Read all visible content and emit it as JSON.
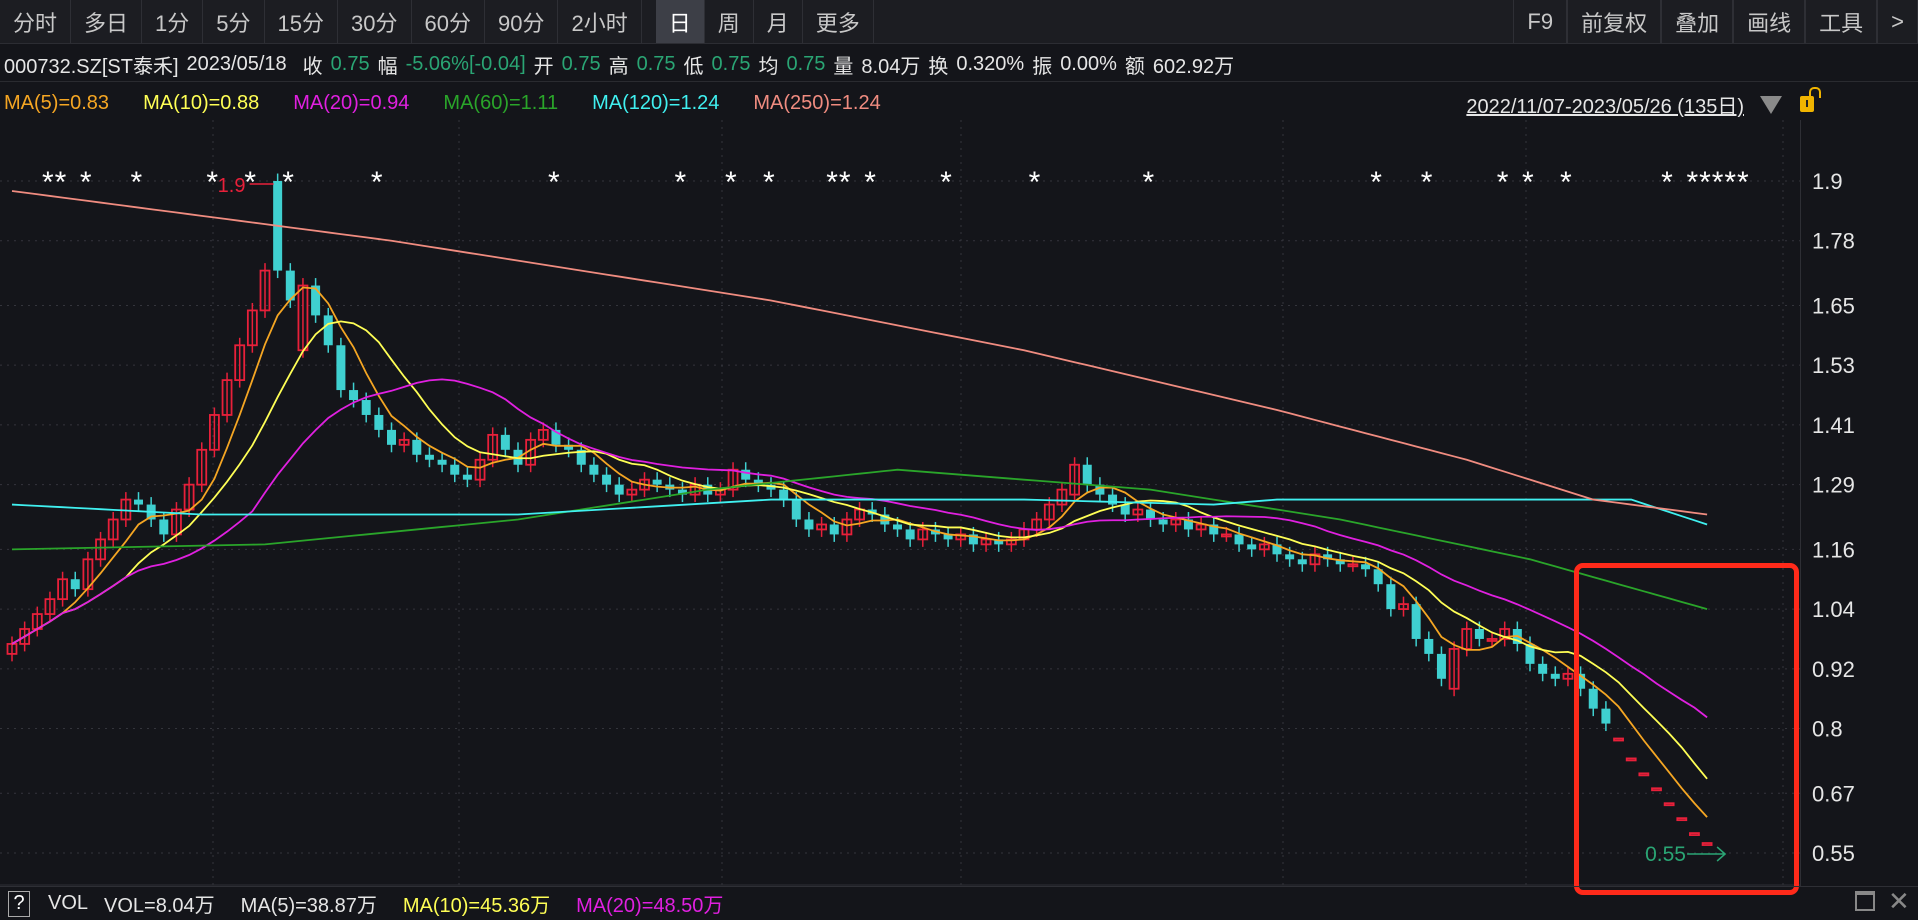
{
  "tabs_left": [
    "分时",
    "多日",
    "1分",
    "5分",
    "15分",
    "30分",
    "60分",
    "90分",
    "2小时",
    "日",
    "周",
    "月",
    "更多"
  ],
  "selected_tab": "日",
  "tabs_right": [
    "F9",
    "前复权",
    "叠加",
    "画线",
    "工具",
    ">"
  ],
  "info": {
    "symbol": "000732.SZ[ST泰禾]",
    "date": "2023/05/18",
    "close_label": "收",
    "close": "0.75",
    "change_label": "幅",
    "change": "-5.06%[-0.04]",
    "open_label": "开",
    "open": "0.75",
    "high_label": "高",
    "high": "0.75",
    "low_label": "低",
    "low": "0.75",
    "avg_label": "均",
    "avg": "0.75",
    "vol_label": "量",
    "vol": "8.04万",
    "turnover_label": "换",
    "turnover": "0.320%",
    "amp_label": "振",
    "amp": "0.00%",
    "amount_label": "额",
    "amount": "602.92万"
  },
  "ma_legend": [
    {
      "text": "MA(5)=0.83",
      "color": "#f5a623"
    },
    {
      "text": "MA(10)=0.88",
      "color": "#ffff55"
    },
    {
      "text": "MA(20)=0.94",
      "color": "#e020e0"
    },
    {
      "text": "MA(60)=1.11",
      "color": "#2aa52a"
    },
    {
      "text": "MA(120)=1.24",
      "color": "#40f0f0"
    },
    {
      "text": "MA(250)=1.24",
      "color": "#f08c80"
    }
  ],
  "range": "2022/11/07-2023/05/26 (135日)",
  "bottom": {
    "help": "?",
    "vol_title": "VOL",
    "vol": "VOL=8.04万",
    "ma5": "MA(5)=38.87万",
    "ma10": "MA(10)=45.36万",
    "ma20": "MA(20)=48.50万"
  },
  "colors": {
    "up": "#e8203a",
    "down": "#3fd0d0",
    "highlight_box": "#ff2a1a"
  },
  "chart_data": {
    "type": "candlestick",
    "ylim": [
      0.55,
      1.9
    ],
    "yticks": [
      "1.9",
      "1.78",
      "1.65",
      "1.53",
      "1.41",
      "1.29",
      "1.16",
      "1.04",
      "0.92",
      "0.8",
      "0.67",
      "0.55"
    ],
    "max_label": "1.9",
    "min_label": "0.55",
    "max_index": 21,
    "min_index": 134,
    "closes": [
      0.97,
      1.0,
      1.03,
      1.06,
      1.1,
      1.08,
      1.14,
      1.18,
      1.22,
      1.26,
      1.25,
      1.22,
      1.19,
      1.24,
      1.29,
      1.36,
      1.43,
      1.5,
      1.57,
      1.64,
      1.72,
      1.72,
      1.66,
      1.69,
      1.63,
      1.57,
      1.48,
      1.46,
      1.43,
      1.4,
      1.37,
      1.38,
      1.35,
      1.34,
      1.33,
      1.31,
      1.3,
      1.34,
      1.39,
      1.36,
      1.33,
      1.38,
      1.4,
      1.37,
      1.36,
      1.33,
      1.31,
      1.29,
      1.27,
      1.28,
      1.3,
      1.29,
      1.28,
      1.27,
      1.29,
      1.27,
      1.28,
      1.32,
      1.3,
      1.29,
      1.28,
      1.26,
      1.22,
      1.2,
      1.21,
      1.19,
      1.22,
      1.24,
      1.23,
      1.21,
      1.2,
      1.18,
      1.2,
      1.19,
      1.18,
      1.19,
      1.17,
      1.18,
      1.17,
      1.18,
      1.2,
      1.22,
      1.25,
      1.28,
      1.33,
      1.29,
      1.27,
      1.25,
      1.23,
      1.24,
      1.22,
      1.21,
      1.22,
      1.2,
      1.21,
      1.19,
      1.19,
      1.17,
      1.16,
      1.17,
      1.15,
      1.14,
      1.13,
      1.15,
      1.14,
      1.13,
      1.13,
      1.12,
      1.09,
      1.04,
      1.05,
      0.98,
      0.95,
      0.9,
      0.96,
      1.0,
      0.98,
      0.98,
      1.0,
      0.97,
      0.93,
      0.91,
      0.9,
      0.91,
      0.88,
      0.84,
      0.81,
      0.78,
      0.74,
      0.71,
      0.68,
      0.65,
      0.62,
      0.59,
      0.57
    ],
    "opens_override": {
      "21": 1.9,
      "23": 1.56,
      "84": 1.27,
      "114": 0.88
    },
    "ma_series": [
      {
        "name": "MA5",
        "color": "#f5a623",
        "period": 5
      },
      {
        "name": "MA10",
        "color": "#ffff55",
        "period": 10
      },
      {
        "name": "MA20",
        "color": "#e020e0",
        "period": 20
      },
      {
        "name": "MA60",
        "color": "#2aa52a",
        "knots": [
          [
            0,
            1.16
          ],
          [
            20,
            1.17
          ],
          [
            40,
            1.22
          ],
          [
            55,
            1.28
          ],
          [
            70,
            1.32
          ],
          [
            90,
            1.28
          ],
          [
            105,
            1.22
          ],
          [
            120,
            1.14
          ],
          [
            134,
            1.04
          ]
        ]
      },
      {
        "name": "MA120",
        "color": "#40f0f0",
        "knots": [
          [
            0,
            1.25
          ],
          [
            15,
            1.23
          ],
          [
            40,
            1.23
          ],
          [
            60,
            1.26
          ],
          [
            80,
            1.26
          ],
          [
            95,
            1.25
          ],
          [
            100,
            1.26
          ],
          [
            128,
            1.26
          ],
          [
            134,
            1.21
          ]
        ]
      },
      {
        "name": "MA250",
        "color": "#f08c80",
        "knots": [
          [
            0,
            1.88
          ],
          [
            30,
            1.78
          ],
          [
            60,
            1.66
          ],
          [
            80,
            1.56
          ],
          [
            100,
            1.44
          ],
          [
            115,
            1.34
          ],
          [
            125,
            1.26
          ],
          [
            134,
            1.23
          ]
        ]
      }
    ],
    "star_indices": [
      3,
      4,
      6,
      10,
      16,
      19,
      22,
      29,
      43,
      53,
      57,
      60,
      65,
      66,
      68,
      74,
      81,
      90,
      108,
      112,
      118,
      120,
      123,
      131,
      133,
      134,
      135,
      136,
      137
    ]
  }
}
